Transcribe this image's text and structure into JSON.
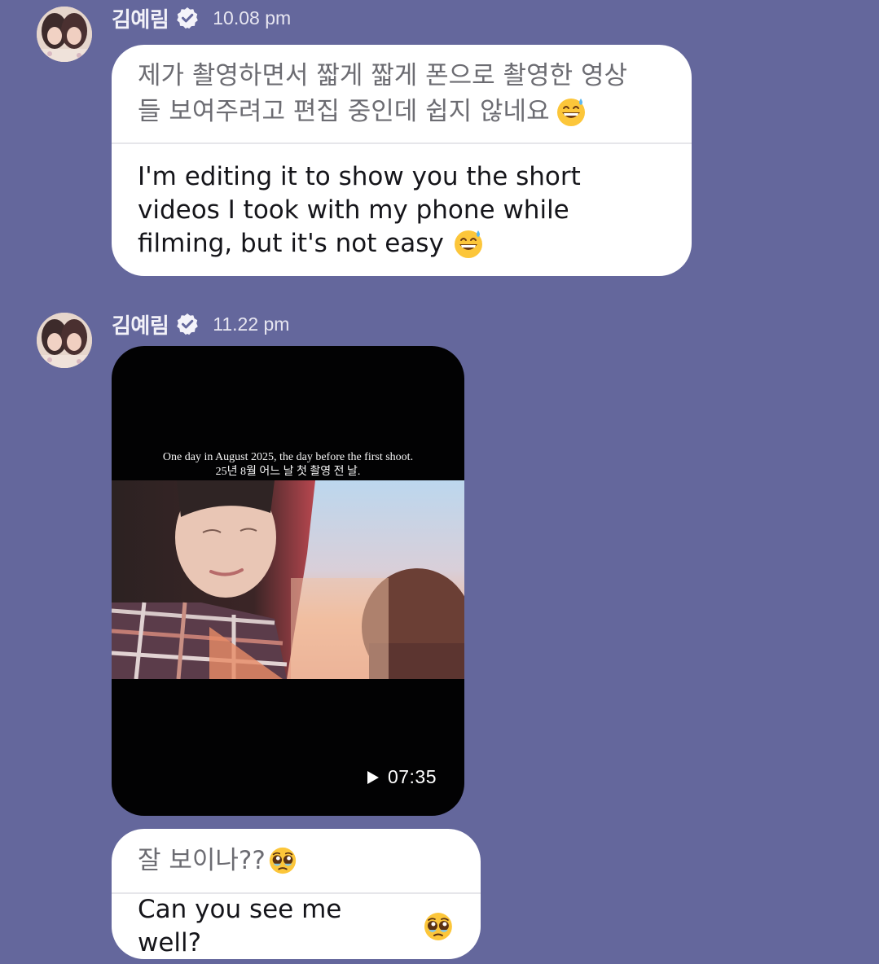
{
  "messages": [
    {
      "sender": "김예림",
      "time": "10.08 pm",
      "original": "제가 촬영하면서 짧게 짧게 폰으로 촬영한 영상들 보여주려고 편집 중인데 쉽지 않네요",
      "original_line1": "제가 촬영하면서 짧게 짧게 폰으로 촬영한 영상",
      "original_line2": "들 보여주려고 편집 중인데 쉽지 않네요",
      "original_emoji": "grinning-sweat-emoji",
      "translation_line1": "I'm editing it to show you the short",
      "translation_line2": "videos I took with my phone while",
      "translation_line3": "filming, but it's not easy",
      "translation_emoji": "grinning-sweat-emoji"
    },
    {
      "sender": "김예림",
      "time": "11.22 pm",
      "video": {
        "caption_en": "One day in August 2025, the day before the first shoot.",
        "caption_ko": "25년 8월 어느 날 첫 촬영 전 날.",
        "duration": "07:35"
      },
      "original": "잘 보이나??",
      "original_emoji": "pleading-face-emoji",
      "translation": "Can you see me well?",
      "translation_emoji": "pleading-face-emoji"
    }
  ],
  "colors": {
    "background": "#64679c",
    "bubble": "#ffffff",
    "original_text": "#6c6c72",
    "translation_text": "#15151a",
    "verified_badge": "#f4f3fa"
  }
}
